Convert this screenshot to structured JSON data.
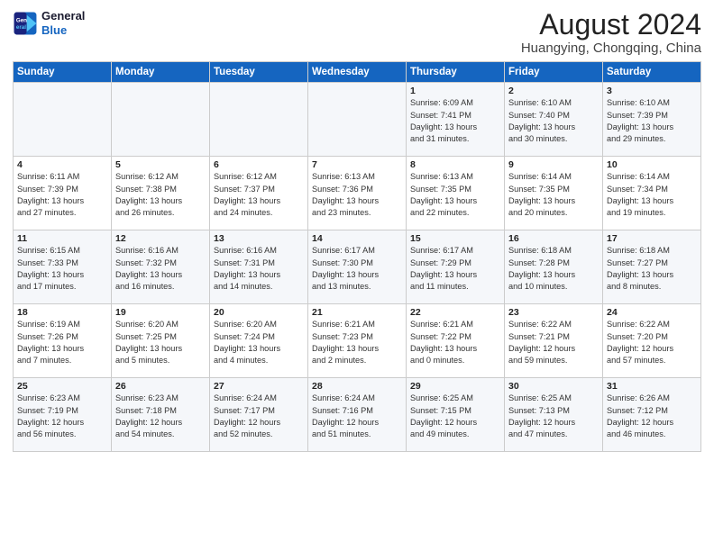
{
  "header": {
    "logo_line1": "General",
    "logo_line2": "Blue",
    "main_title": "August 2024",
    "subtitle": "Huangying, Chongqing, China"
  },
  "weekdays": [
    "Sunday",
    "Monday",
    "Tuesday",
    "Wednesday",
    "Thursday",
    "Friday",
    "Saturday"
  ],
  "weeks": [
    [
      {
        "day": "",
        "info": ""
      },
      {
        "day": "",
        "info": ""
      },
      {
        "day": "",
        "info": ""
      },
      {
        "day": "",
        "info": ""
      },
      {
        "day": "1",
        "info": "Sunrise: 6:09 AM\nSunset: 7:41 PM\nDaylight: 13 hours\nand 31 minutes."
      },
      {
        "day": "2",
        "info": "Sunrise: 6:10 AM\nSunset: 7:40 PM\nDaylight: 13 hours\nand 30 minutes."
      },
      {
        "day": "3",
        "info": "Sunrise: 6:10 AM\nSunset: 7:39 PM\nDaylight: 13 hours\nand 29 minutes."
      }
    ],
    [
      {
        "day": "4",
        "info": "Sunrise: 6:11 AM\nSunset: 7:39 PM\nDaylight: 13 hours\nand 27 minutes."
      },
      {
        "day": "5",
        "info": "Sunrise: 6:12 AM\nSunset: 7:38 PM\nDaylight: 13 hours\nand 26 minutes."
      },
      {
        "day": "6",
        "info": "Sunrise: 6:12 AM\nSunset: 7:37 PM\nDaylight: 13 hours\nand 24 minutes."
      },
      {
        "day": "7",
        "info": "Sunrise: 6:13 AM\nSunset: 7:36 PM\nDaylight: 13 hours\nand 23 minutes."
      },
      {
        "day": "8",
        "info": "Sunrise: 6:13 AM\nSunset: 7:35 PM\nDaylight: 13 hours\nand 22 minutes."
      },
      {
        "day": "9",
        "info": "Sunrise: 6:14 AM\nSunset: 7:35 PM\nDaylight: 13 hours\nand 20 minutes."
      },
      {
        "day": "10",
        "info": "Sunrise: 6:14 AM\nSunset: 7:34 PM\nDaylight: 13 hours\nand 19 minutes."
      }
    ],
    [
      {
        "day": "11",
        "info": "Sunrise: 6:15 AM\nSunset: 7:33 PM\nDaylight: 13 hours\nand 17 minutes."
      },
      {
        "day": "12",
        "info": "Sunrise: 6:16 AM\nSunset: 7:32 PM\nDaylight: 13 hours\nand 16 minutes."
      },
      {
        "day": "13",
        "info": "Sunrise: 6:16 AM\nSunset: 7:31 PM\nDaylight: 13 hours\nand 14 minutes."
      },
      {
        "day": "14",
        "info": "Sunrise: 6:17 AM\nSunset: 7:30 PM\nDaylight: 13 hours\nand 13 minutes."
      },
      {
        "day": "15",
        "info": "Sunrise: 6:17 AM\nSunset: 7:29 PM\nDaylight: 13 hours\nand 11 minutes."
      },
      {
        "day": "16",
        "info": "Sunrise: 6:18 AM\nSunset: 7:28 PM\nDaylight: 13 hours\nand 10 minutes."
      },
      {
        "day": "17",
        "info": "Sunrise: 6:18 AM\nSunset: 7:27 PM\nDaylight: 13 hours\nand 8 minutes."
      }
    ],
    [
      {
        "day": "18",
        "info": "Sunrise: 6:19 AM\nSunset: 7:26 PM\nDaylight: 13 hours\nand 7 minutes."
      },
      {
        "day": "19",
        "info": "Sunrise: 6:20 AM\nSunset: 7:25 PM\nDaylight: 13 hours\nand 5 minutes."
      },
      {
        "day": "20",
        "info": "Sunrise: 6:20 AM\nSunset: 7:24 PM\nDaylight: 13 hours\nand 4 minutes."
      },
      {
        "day": "21",
        "info": "Sunrise: 6:21 AM\nSunset: 7:23 PM\nDaylight: 13 hours\nand 2 minutes."
      },
      {
        "day": "22",
        "info": "Sunrise: 6:21 AM\nSunset: 7:22 PM\nDaylight: 13 hours\nand 0 minutes."
      },
      {
        "day": "23",
        "info": "Sunrise: 6:22 AM\nSunset: 7:21 PM\nDaylight: 12 hours\nand 59 minutes."
      },
      {
        "day": "24",
        "info": "Sunrise: 6:22 AM\nSunset: 7:20 PM\nDaylight: 12 hours\nand 57 minutes."
      }
    ],
    [
      {
        "day": "25",
        "info": "Sunrise: 6:23 AM\nSunset: 7:19 PM\nDaylight: 12 hours\nand 56 minutes."
      },
      {
        "day": "26",
        "info": "Sunrise: 6:23 AM\nSunset: 7:18 PM\nDaylight: 12 hours\nand 54 minutes."
      },
      {
        "day": "27",
        "info": "Sunrise: 6:24 AM\nSunset: 7:17 PM\nDaylight: 12 hours\nand 52 minutes."
      },
      {
        "day": "28",
        "info": "Sunrise: 6:24 AM\nSunset: 7:16 PM\nDaylight: 12 hours\nand 51 minutes."
      },
      {
        "day": "29",
        "info": "Sunrise: 6:25 AM\nSunset: 7:15 PM\nDaylight: 12 hours\nand 49 minutes."
      },
      {
        "day": "30",
        "info": "Sunrise: 6:25 AM\nSunset: 7:13 PM\nDaylight: 12 hours\nand 47 minutes."
      },
      {
        "day": "31",
        "info": "Sunrise: 6:26 AM\nSunset: 7:12 PM\nDaylight: 12 hours\nand 46 minutes."
      }
    ]
  ]
}
